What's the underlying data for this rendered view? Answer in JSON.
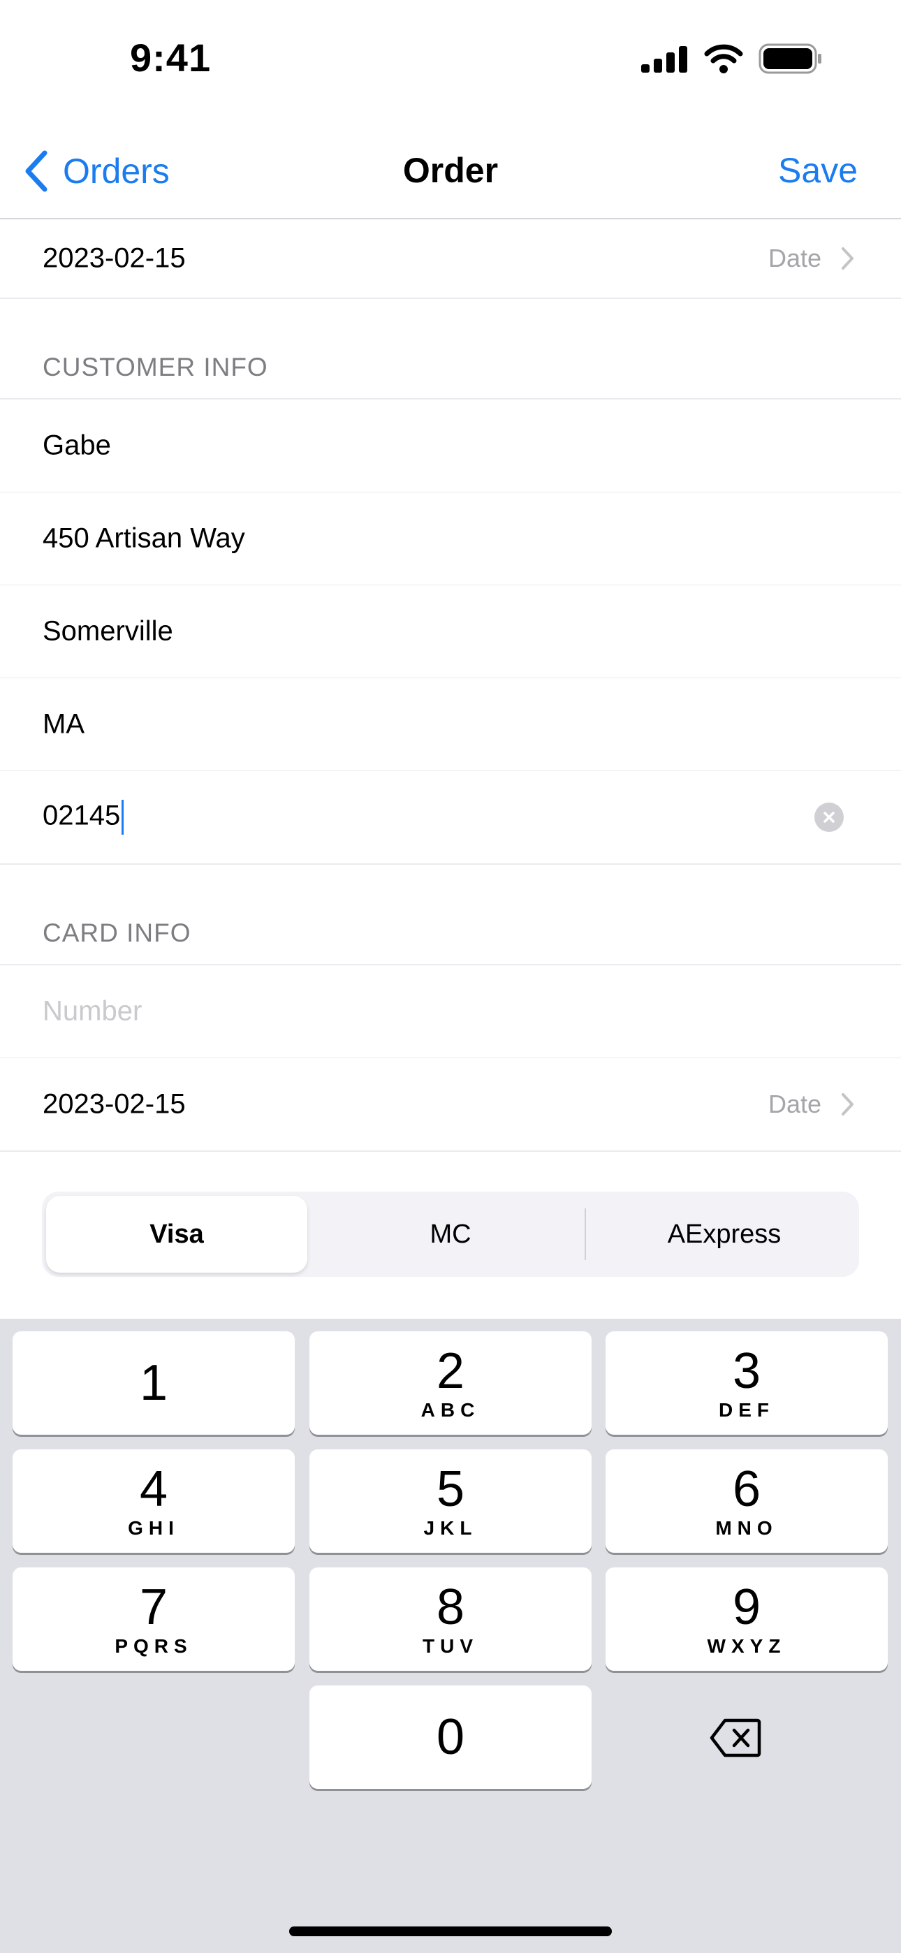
{
  "status_bar": {
    "time": "9:41"
  },
  "nav": {
    "back_label": "Orders",
    "title": "Order",
    "save_label": "Save"
  },
  "order_date": {
    "value": "2023-02-15",
    "detail": "Date"
  },
  "customer_info": {
    "header": "CUSTOMER INFO",
    "name": "Gabe",
    "street": "450 Artisan Way",
    "city": "Somerville",
    "state": "MA",
    "zip": "02145"
  },
  "card_info": {
    "header": "CARD INFO",
    "number_placeholder": "Number",
    "expiry": {
      "value": "2023-02-15",
      "detail": "Date"
    },
    "types": [
      "Visa",
      "MC",
      "AExpress"
    ],
    "selected_type": "Visa"
  },
  "keyboard": {
    "keys": [
      {
        "num": "1",
        "letters": ""
      },
      {
        "num": "2",
        "letters": "ABC"
      },
      {
        "num": "3",
        "letters": "DEF"
      },
      {
        "num": "4",
        "letters": "GHI"
      },
      {
        "num": "5",
        "letters": "JKL"
      },
      {
        "num": "6",
        "letters": "MNO"
      },
      {
        "num": "7",
        "letters": "PQRS"
      },
      {
        "num": "8",
        "letters": "TUV"
      },
      {
        "num": "9",
        "letters": "WXYZ"
      },
      {
        "num": "0",
        "letters": ""
      }
    ]
  },
  "colors": {
    "accent": "#1a7cf0",
    "keyboard_bg": "#dfe0e6",
    "secondary_text": "#7d7d82"
  }
}
